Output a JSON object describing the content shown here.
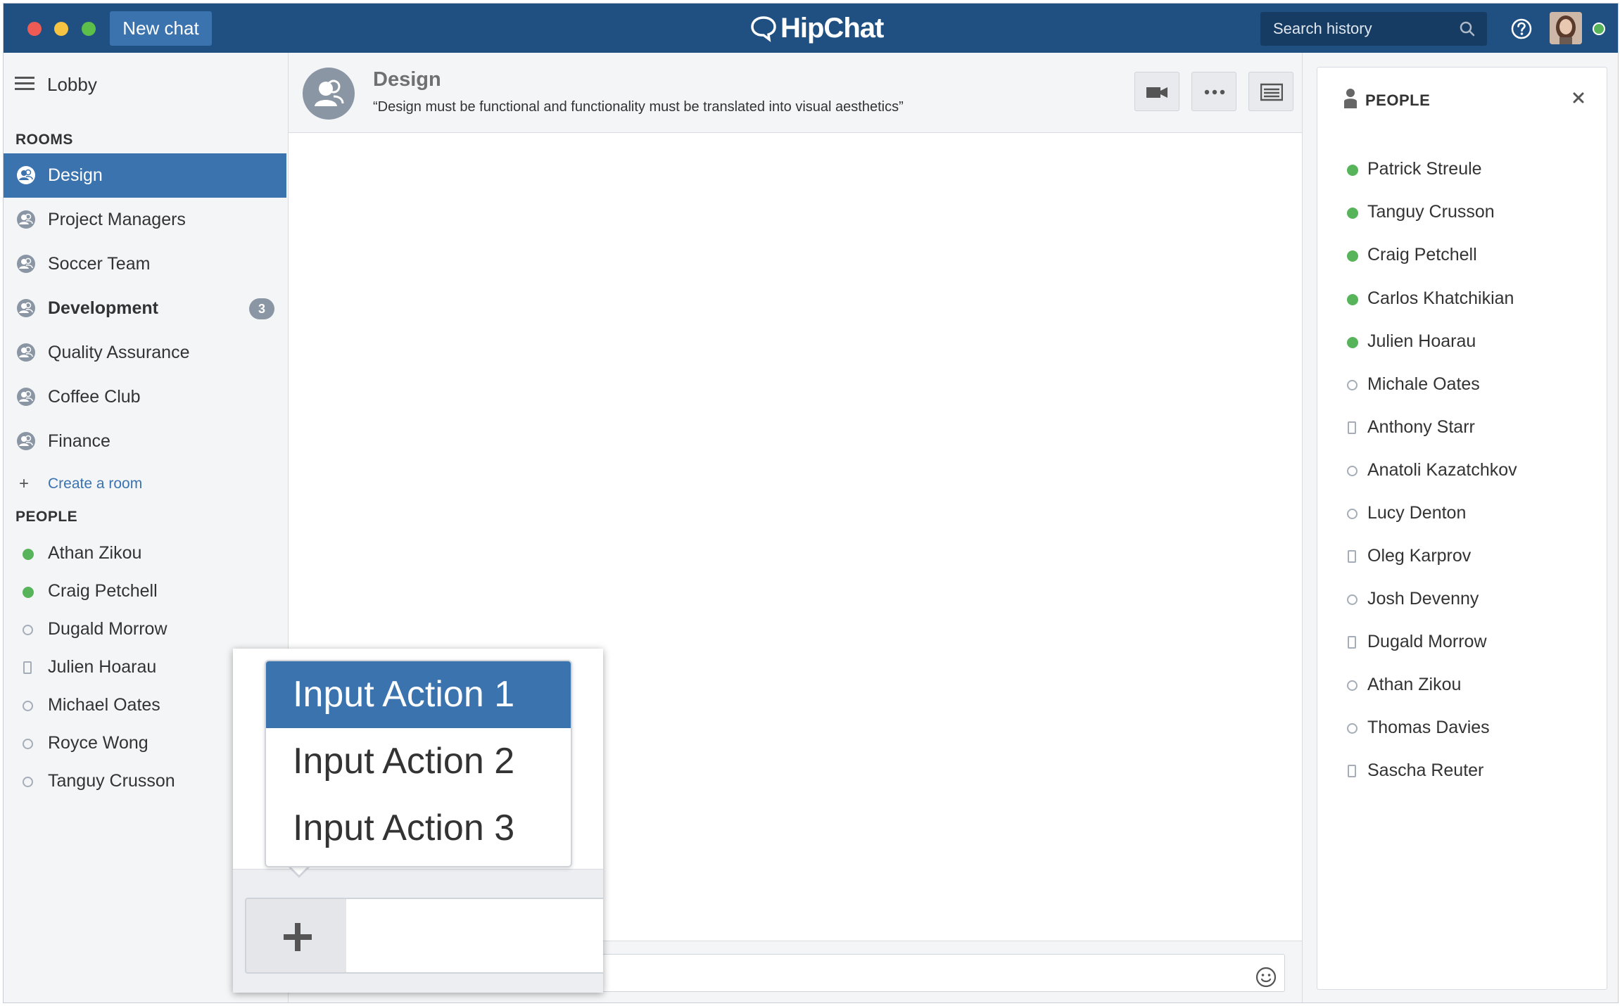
{
  "titlebar": {
    "new_chat_label": "New chat",
    "logo_text": "HipChat",
    "search_placeholder": "Search history"
  },
  "sidebar": {
    "lobby_label": "Lobby",
    "rooms_heading": "ROOMS",
    "rooms": [
      {
        "label": "Design",
        "active": true
      },
      {
        "label": "Project Managers"
      },
      {
        "label": "Soccer Team"
      },
      {
        "label": "Development",
        "bold": true,
        "badge": "3"
      },
      {
        "label": "Quality Assurance"
      },
      {
        "label": "Coffee Club"
      },
      {
        "label": "Finance"
      }
    ],
    "create_room_label": "Create a room",
    "people_heading": "PEOPLE",
    "people": [
      {
        "name": "Athan Zikou",
        "status": "online"
      },
      {
        "name": "Craig Petchell",
        "status": "online"
      },
      {
        "name": "Dugald Morrow",
        "status": "offline"
      },
      {
        "name": "Julien Hoarau",
        "status": "mobile"
      },
      {
        "name": "Michael Oates",
        "status": "offline"
      },
      {
        "name": "Royce Wong",
        "status": "offline"
      },
      {
        "name": "Tanguy Crusson",
        "status": "offline"
      }
    ]
  },
  "room": {
    "title": "Design",
    "topic": "“Design must be functional and functionality must be translated into visual aesthetics”"
  },
  "people_panel": {
    "title": "PEOPLE",
    "people": [
      {
        "name": "Patrick Streule",
        "status": "online"
      },
      {
        "name": "Tanguy Crusson",
        "status": "online"
      },
      {
        "name": "Craig Petchell",
        "status": "online"
      },
      {
        "name": "Carlos Khatchikian",
        "status": "online"
      },
      {
        "name": "Julien Hoarau",
        "status": "online"
      },
      {
        "name": "Michale Oates",
        "status": "offline"
      },
      {
        "name": "Anthony Starr",
        "status": "mobile"
      },
      {
        "name": "Anatoli Kazatchkov",
        "status": "offline"
      },
      {
        "name": "Lucy Denton",
        "status": "offline"
      },
      {
        "name": "Oleg Karprov",
        "status": "mobile"
      },
      {
        "name": "Josh Devenny",
        "status": "offline"
      },
      {
        "name": "Dugald Morrow",
        "status": "mobile"
      },
      {
        "name": "Athan Zikou",
        "status": "offline"
      },
      {
        "name": "Thomas Davies",
        "status": "offline"
      },
      {
        "name": "Sascha Reuter",
        "status": "mobile"
      }
    ]
  },
  "input_actions": {
    "items": [
      "Input Action 1",
      "Input Action 2",
      "Input Action 3"
    ],
    "selected_index": 0
  },
  "colors": {
    "titlebar": "#205081",
    "accent": "#3b73af",
    "online": "#57b45a",
    "sidebar_bg": "#f4f5f7"
  },
  "icons": {
    "room": "room-people-icon",
    "search": "search-icon",
    "help": "help-icon",
    "video": "video-camera-icon",
    "more": "more-dots-icon",
    "toggle_sidebar": "list-icon",
    "emoji": "smiley-icon",
    "add": "plus-icon",
    "close": "close-icon"
  }
}
